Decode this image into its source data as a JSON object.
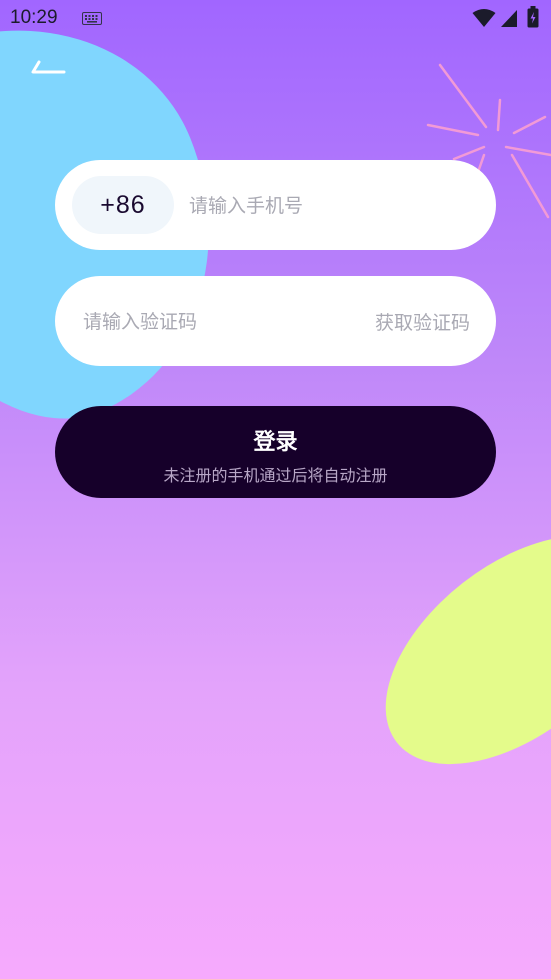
{
  "status_bar": {
    "time": "10:29",
    "icons": [
      "keyboard-icon",
      "wifi-icon",
      "signal-icon",
      "battery-charging-icon"
    ]
  },
  "navigation": {
    "back_icon": "back-arrow-icon"
  },
  "phone": {
    "country_code": "+86",
    "placeholder": "请输入手机号",
    "value": ""
  },
  "verification": {
    "placeholder": "请输入验证码",
    "value": "",
    "get_code_label": "获取验证码"
  },
  "login": {
    "label": "登录",
    "hint": "未注册的手机通过后将自动注册"
  },
  "colors": {
    "background_top": "#a166ff",
    "background_bottom": "#f6aafd",
    "blob_blue": "#80d6fe",
    "blob_yellow": "#e4fb8b",
    "button_dark": "#16002a",
    "placeholder_gray": "#a9a9b3"
  }
}
